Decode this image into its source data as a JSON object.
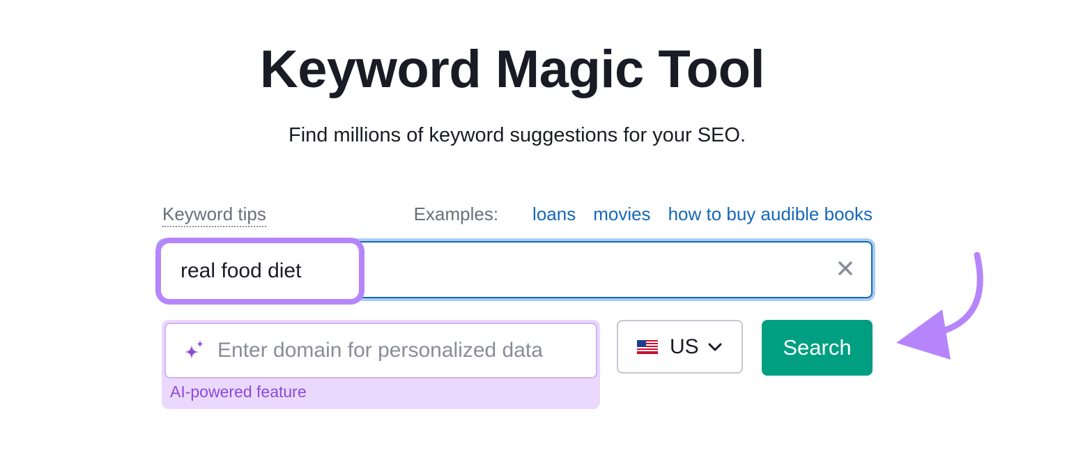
{
  "header": {
    "title": "Keyword Magic Tool",
    "subtitle": "Find millions of keyword suggestions for your SEO."
  },
  "tips": {
    "label": "Keyword tips"
  },
  "examples": {
    "label": "Examples:",
    "items": [
      "loans",
      "movies",
      "how to buy audible books"
    ]
  },
  "keyword_input": {
    "value": "real food diet",
    "clear_icon": "close-icon"
  },
  "domain_input": {
    "placeholder": "Enter domain for personalized data",
    "value": "",
    "icon": "sparkle-icon",
    "caption": "AI-powered feature"
  },
  "country_select": {
    "selected": "US",
    "flag_icon": "us-flag-icon",
    "dropdown_icon": "chevron-down-icon"
  },
  "search_button": {
    "label": "Search"
  },
  "colors": {
    "accent_green": "#009f81",
    "link_blue": "#1667b8",
    "highlight_purple": "#b685fb",
    "ai_purple": "#8b4bd8",
    "ai_bg": "#ebd8fd"
  }
}
